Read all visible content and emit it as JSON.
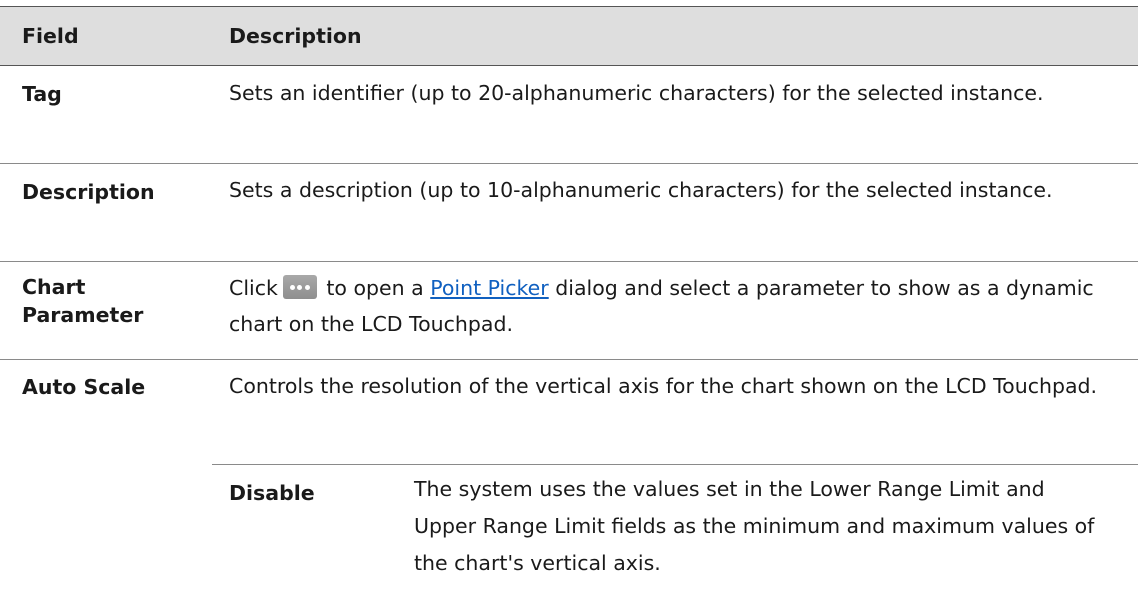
{
  "header": {
    "field": "Field",
    "description": "Description"
  },
  "rows": [
    {
      "field": "Tag",
      "description": "Sets an identifier (up to 20-alphanumeric characters) for the selected instance."
    },
    {
      "field": "Description",
      "description": "Sets a description (up to 10-alphanumeric characters) for the selected instance."
    },
    {
      "field_line1": "Chart",
      "field_line2": "Parameter",
      "desc_before": "Click",
      "button_icon": "ellipsis-button-icon",
      "desc_mid": " to open a ",
      "link_text": "Point Picker",
      "desc_after": " dialog and select a parameter to show as a dynamic chart on the LCD Touchpad."
    },
    {
      "field": "Auto Scale",
      "description": "Controls the resolution of the vertical axis for the chart shown on the LCD Touchpad.",
      "options": [
        {
          "name": "Disable",
          "description": "The system uses the values set in the Lower Range Limit and Upper Range Limit fields as the minimum and maximum values of the chart's vertical axis."
        }
      ]
    }
  ],
  "colors": {
    "header_bg": "#dedede",
    "link": "#1060c0",
    "button_bg": "#999999"
  }
}
